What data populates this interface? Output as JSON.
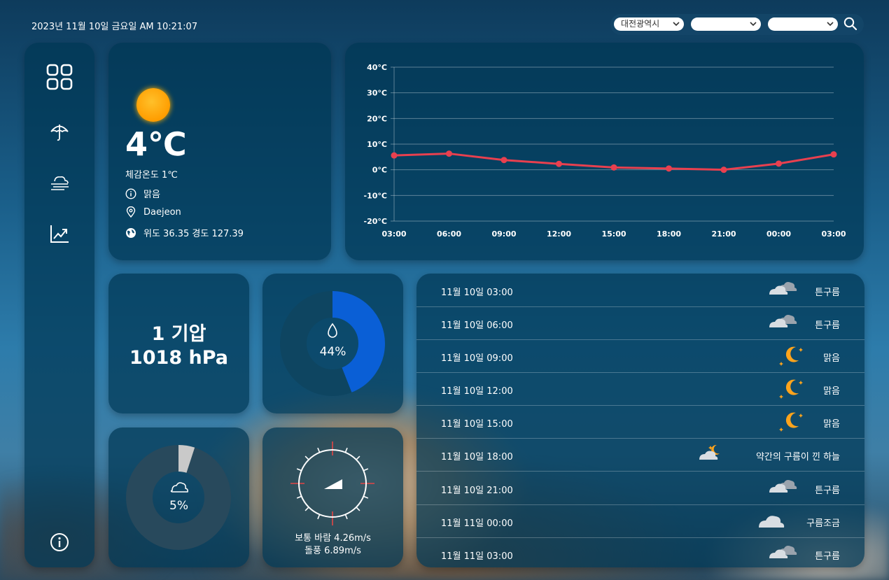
{
  "datetime": "2023년 11월 10일 금요일 AM 10:21:07",
  "location_select": {
    "city": "대전광역시",
    "district": "",
    "town": ""
  },
  "sidebar": {
    "items": [
      "dashboard",
      "rain",
      "fog",
      "trend"
    ],
    "info_icon": "info-icon"
  },
  "current": {
    "temp": "4℃",
    "feels_like": "체감온도 1℃",
    "condition": "맑음",
    "city": "Daejeon",
    "coords": "위도 36.35 경도 127.39"
  },
  "chart_data": {
    "type": "line",
    "x": [
      "03:00",
      "06:00",
      "09:00",
      "12:00",
      "15:00",
      "18:00",
      "21:00",
      "00:00",
      "03:00"
    ],
    "y_ticks": [
      "40°C",
      "30°C",
      "20°C",
      "10°C",
      "0°C",
      "-10°C",
      "-20°C"
    ],
    "ylim": [
      -20,
      40
    ],
    "series": [
      {
        "values": [
          5.6,
          6.3,
          3.8,
          2.3,
          0.9,
          0.5,
          0.0,
          2.4,
          6.0
        ],
        "color": "#e8404f"
      }
    ],
    "grid": true
  },
  "pressure": {
    "line1": "1 기압",
    "line2": "1018 hPa"
  },
  "humidity": {
    "value": "44%",
    "percent": 44,
    "color": "#0a5fd6"
  },
  "clouds": {
    "value": "5%",
    "percent": 5
  },
  "wind": {
    "line1": "보통 바람 4.26m/s",
    "line2": "돌풍 6.89m/s"
  },
  "forecast": [
    {
      "time": "11월 10일 03:00",
      "desc": "튼구름",
      "icon": "broken-clouds-icon"
    },
    {
      "time": "11월 10일 06:00",
      "desc": "튼구름",
      "icon": "broken-clouds-icon"
    },
    {
      "time": "11월 10일 09:00",
      "desc": "맑음",
      "icon": "clear-night-icon"
    },
    {
      "time": "11월 10일 12:00",
      "desc": "맑음",
      "icon": "clear-night-icon"
    },
    {
      "time": "11월 10일 15:00",
      "desc": "맑음",
      "icon": "clear-night-icon"
    },
    {
      "time": "11월 10일 18:00",
      "desc": "약간의 구름이 낀 하늘",
      "icon": "few-clouds-night-icon"
    },
    {
      "time": "11월 10일 21:00",
      "desc": "튼구름",
      "icon": "broken-clouds-icon"
    },
    {
      "time": "11월 11일 00:00",
      "desc": "구름조금",
      "icon": "scattered-clouds-icon"
    },
    {
      "time": "11월 11일 03:00",
      "desc": "튼구름",
      "icon": "broken-clouds-icon"
    }
  ]
}
